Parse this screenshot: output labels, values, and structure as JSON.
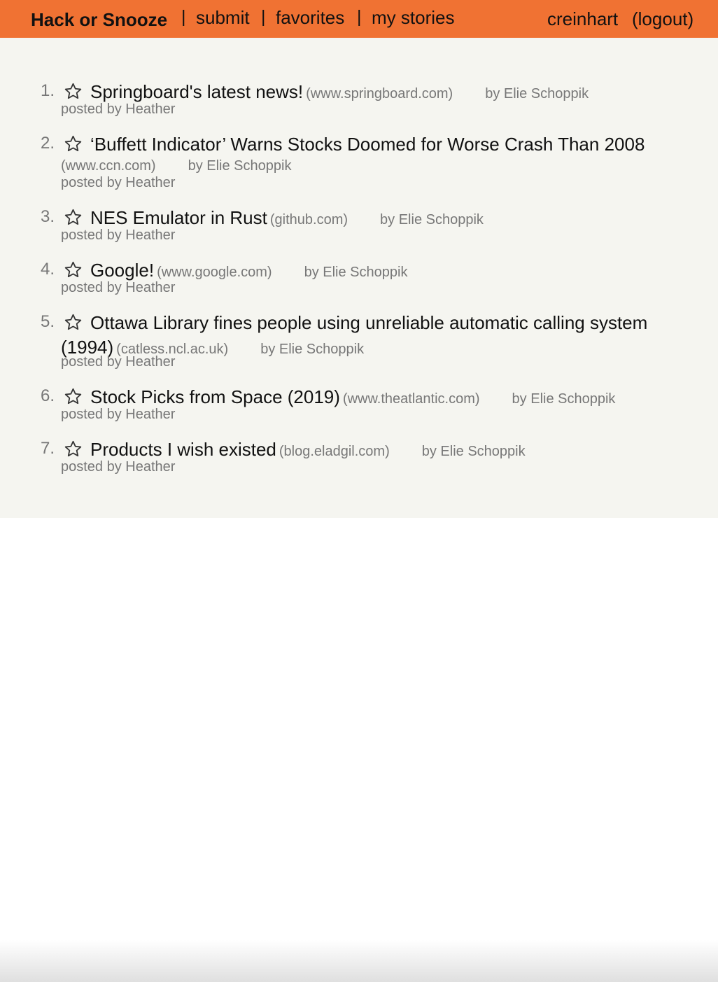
{
  "nav": {
    "brand": "Hack or Snooze",
    "submit": "submit",
    "favorites": "favorites",
    "my_stories": "my stories",
    "separator": "|",
    "username": "creinhart",
    "logout": "(logout)",
    "bar_color": "#f07233"
  },
  "stories": [
    {
      "number": "1.",
      "title": "Springboard's latest news!",
      "host": "(www.springboard.com)",
      "author": "by Elie Schoppik",
      "poster": "posted by Heather",
      "favorite": false
    },
    {
      "number": "2.",
      "title": "‘Buffett Indicator’ Warns Stocks Doomed for Worse Crash Than 2008",
      "host": "(www.ccn.com)",
      "author": "by Elie Schoppik",
      "poster": "posted by Heather",
      "favorite": false
    },
    {
      "number": "3.",
      "title": "NES Emulator in Rust",
      "host": "(github.com)",
      "author": "by Elie Schoppik",
      "poster": "posted by Heather",
      "favorite": false
    },
    {
      "number": "4.",
      "title": "Google!",
      "host": "(www.google.com)",
      "author": "by Elie Schoppik",
      "poster": "posted by Heather",
      "favorite": false
    },
    {
      "number": "5.",
      "title": "Ottawa Library fines people using unreliable automatic calling system (1994)",
      "host": "(catless.ncl.ac.uk)",
      "author": "by Elie Schoppik",
      "poster": "posted by Heather",
      "favorite": false
    },
    {
      "number": "6.",
      "title": "Stock Picks from Space (2019)",
      "host": "(www.theatlantic.com)",
      "author": "by Elie Schoppik",
      "poster": "posted by Heather",
      "favorite": false
    },
    {
      "number": "7.",
      "title": "Products I wish existed",
      "host": "(blog.eladgil.com)",
      "author": "by Elie Schoppik",
      "poster": "posted by Heather",
      "favorite": false
    }
  ]
}
